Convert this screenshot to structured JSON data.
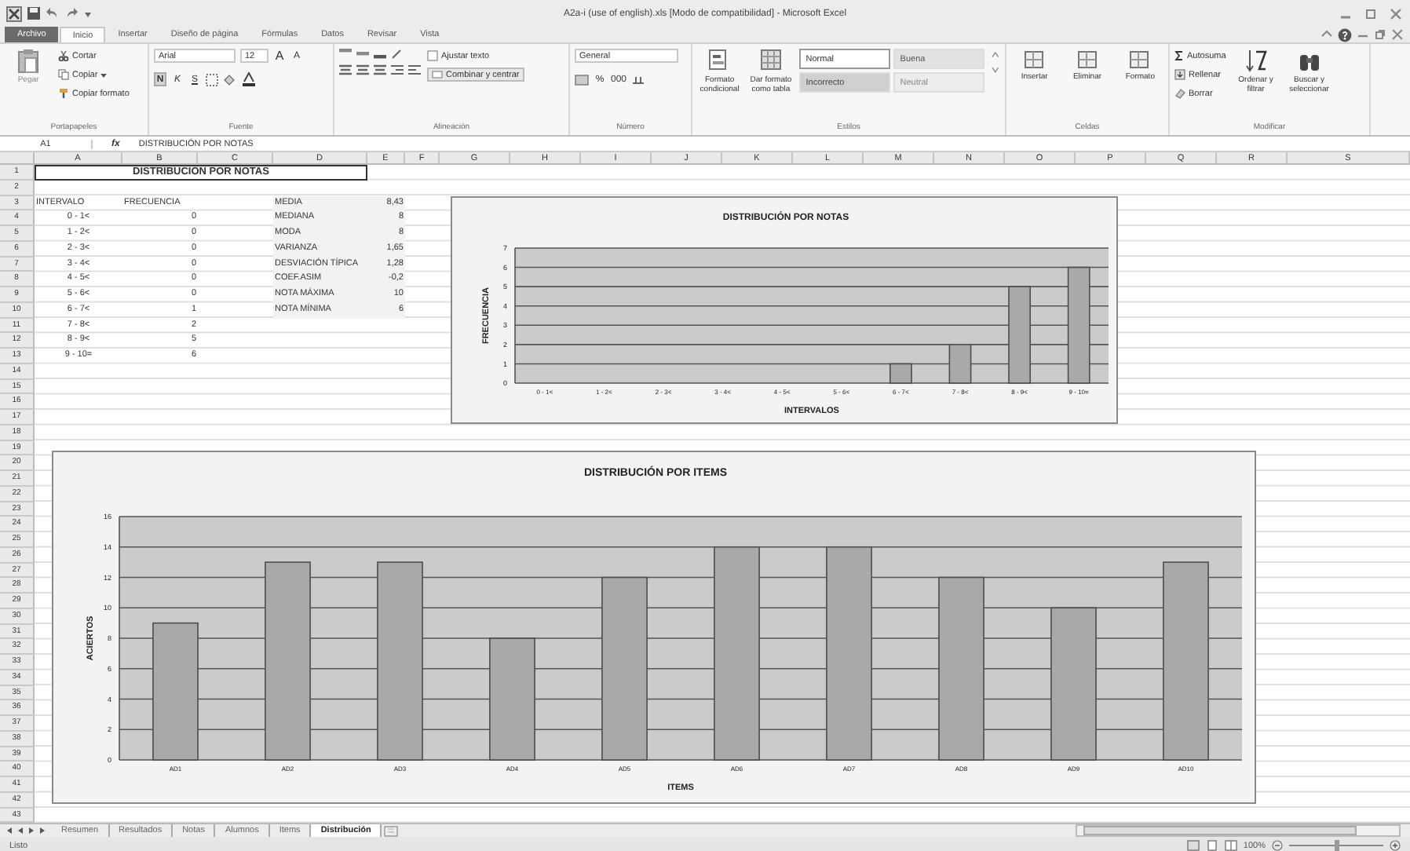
{
  "window": {
    "title": "A2a-i (use of english).xls  [Modo de compatibilidad]  -  Microsoft Excel"
  },
  "ribbon_tabs": [
    {
      "label": "Archivo",
      "kind": "file",
      "selected": false
    },
    {
      "label": "Inicio",
      "kind": "tab",
      "selected": true
    },
    {
      "label": "Insertar",
      "kind": "tab",
      "selected": false
    },
    {
      "label": "Diseño de página",
      "kind": "tab",
      "selected": false
    },
    {
      "label": "Fórmulas",
      "kind": "tab",
      "selected": false
    },
    {
      "label": "Datos",
      "kind": "tab",
      "selected": false
    },
    {
      "label": "Revisar",
      "kind": "tab",
      "selected": false
    },
    {
      "label": "Vista",
      "kind": "tab",
      "selected": false
    }
  ],
  "ribbon": {
    "clipboard": {
      "label": "Portapapeles",
      "paste": "Pegar",
      "cut": "Cortar",
      "copy": "Copiar",
      "format_painter": "Copiar formato"
    },
    "font": {
      "label": "Fuente",
      "family": "Arial",
      "size": "12",
      "style_buttons": [
        "N",
        "K",
        "S"
      ],
      "size_buttons": [
        "A",
        "A"
      ]
    },
    "alignment": {
      "label": "Alineación",
      "wrap_text": "Ajustar texto",
      "merge": "Combinar y centrar"
    },
    "number": {
      "label": "Número",
      "format": "General",
      "buttons": [
        "%",
        "000"
      ]
    },
    "styles": {
      "label": "Estilos",
      "conditional": "Formato condicional",
      "as_table": "Dar formato como tabla",
      "cell_styles": [
        {
          "name": "Normal",
          "kind": "normal"
        },
        {
          "name": "Buena",
          "kind": "good"
        },
        {
          "name": "Incorrecto",
          "kind": "bad"
        },
        {
          "name": "Neutral",
          "kind": "neutral"
        }
      ]
    },
    "cells": {
      "label": "Celdas",
      "buttons": [
        "Insertar",
        "Eliminar",
        "Formato"
      ]
    },
    "editing": {
      "label": "Modificar",
      "autosum": "Autosuma",
      "fill": "Rellenar",
      "clear": "Borrar",
      "sort": "Ordenar y filtrar",
      "find": "Buscar y seleccionar"
    }
  },
  "formula_bar": {
    "name_box": "A1",
    "fx": "fx",
    "formula": "DISTRIBUCIÓN POR NOTAS"
  },
  "sheet": {
    "columns": [
      "A",
      "B",
      "C",
      "D",
      "E",
      "F",
      "G",
      "H",
      "I",
      "J",
      "K",
      "L",
      "M",
      "N",
      "O",
      "P",
      "Q",
      "R",
      "S"
    ],
    "row_numbers": [
      "1",
      "2",
      "3",
      "4",
      "5",
      "6",
      "7",
      "8",
      "9",
      "10",
      "11",
      "12",
      "13",
      "14",
      "15",
      "16",
      "17",
      "18",
      "19",
      "20",
      "21",
      "22",
      "23",
      "24",
      "25",
      "26",
      "27",
      "28",
      "29",
      "30",
      "31",
      "32",
      "33",
      "34",
      "35",
      "36",
      "37",
      "38",
      "39",
      "40",
      "41",
      "42",
      "43"
    ],
    "title": "DISTRIBUCIÓN POR NOTAS",
    "frequency_headers": [
      "INTERVALO",
      "FRECUENCIA"
    ],
    "frequency_rows": [
      {
        "interval": "0 - 1<",
        "count": "0"
      },
      {
        "interval": "1 - 2<",
        "count": "0"
      },
      {
        "interval": "2 - 3<",
        "count": "0"
      },
      {
        "interval": "3 - 4<",
        "count": "0"
      },
      {
        "interval": "4 - 5<",
        "count": "0"
      },
      {
        "interval": "5 - 6<",
        "count": "0"
      },
      {
        "interval": "6 - 7<",
        "count": "1"
      },
      {
        "interval": "7 - 8<",
        "count": "2"
      },
      {
        "interval": "8 - 9<",
        "count": "5"
      },
      {
        "interval": "9 - 10=",
        "count": "6"
      }
    ],
    "statistics": [
      {
        "label": "MEDIA",
        "value": "8,43"
      },
      {
        "label": "MEDIANA",
        "value": "8"
      },
      {
        "label": "MODA",
        "value": "8"
      },
      {
        "label": "VARIANZA",
        "value": "1,65"
      },
      {
        "label": "DESVIACIÓN TÍPICA",
        "value": "1,28"
      },
      {
        "label": "COEF.ASIM",
        "value": "-0,2"
      },
      {
        "label": "NOTA MÁXIMA",
        "value": "10"
      },
      {
        "label": "NOTA MÍNIMA",
        "value": "6"
      }
    ],
    "charts": [
      {
        "chart_data": {
          "type": "bar",
          "title": "DISTRIBUCIÓN POR NOTAS",
          "xlabel": "INTERVALOS",
          "ylabel": "FRECUENCIA",
          "categories": [
            "0 - 1<",
            "1 - 2<",
            "2 - 3<",
            "3 - 4<",
            "4 - 5<",
            "5 - 6<",
            "6 - 7<",
            "7 - 8<",
            "8 - 9<",
            "9 - 10="
          ],
          "values": [
            0,
            0,
            0,
            0,
            0,
            0,
            1,
            2,
            5,
            6
          ],
          "ylim": [
            0,
            7
          ],
          "yticks": [
            0,
            1,
            2,
            3,
            4,
            5,
            6,
            7
          ],
          "grid": true
        }
      },
      {
        "chart_data": {
          "type": "bar",
          "title": "DISTRIBUCIÓN POR ITEMS",
          "xlabel": "ITEMS",
          "ylabel": "ACIERTOS",
          "categories": [
            "AD1",
            "AD2",
            "AD3",
            "AD4",
            "AD5",
            "AD6",
            "AD7",
            "AD8",
            "AD9",
            "AD10"
          ],
          "values": [
            9,
            13,
            13,
            8,
            12,
            14,
            14,
            12,
            10,
            13
          ],
          "ylim": [
            0,
            16
          ],
          "yticks": [
            0,
            2,
            4,
            6,
            8,
            10,
            12,
            14,
            16
          ],
          "grid": true
        }
      }
    ]
  },
  "sheet_tabs": [
    {
      "label": "Resumen",
      "selected": false
    },
    {
      "label": "Resultados",
      "selected": false
    },
    {
      "label": "Notas",
      "selected": false
    },
    {
      "label": "Alumnos",
      "selected": false
    },
    {
      "label": "Items",
      "selected": false
    },
    {
      "label": "Distribución",
      "selected": true
    }
  ],
  "status_bar": {
    "status": "Listo",
    "zoom": "100%",
    "zoom_slider": {
      "level": 0.5
    }
  }
}
